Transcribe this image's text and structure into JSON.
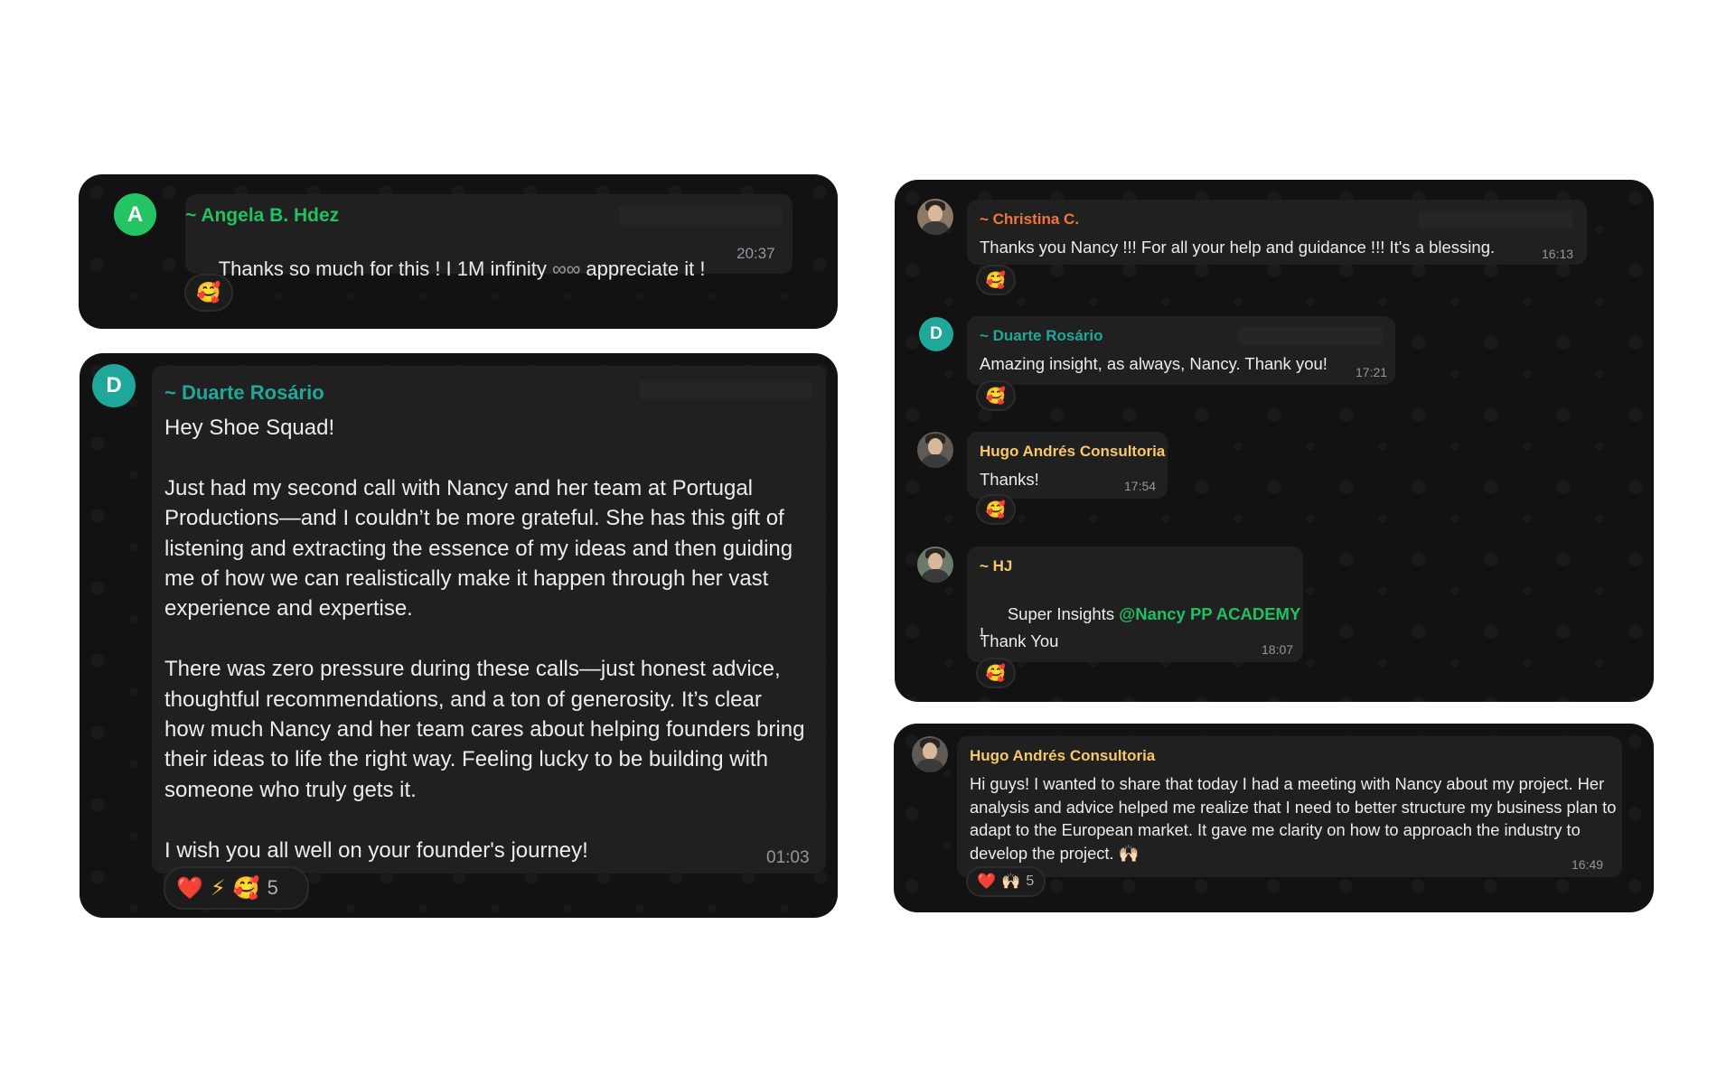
{
  "colors": {
    "card_bg": "#121212",
    "bubble_bg": "#202020",
    "text": "#e9edef",
    "meta": "#8f989e",
    "green": "#21c063",
    "teal": "#1fa89a",
    "orange": "#f0753a",
    "yellow": "#f7c76a"
  },
  "card1": {
    "avatar_letter": "A",
    "sender": "~ Angela B. Hdez",
    "text_before": "Thanks so much for this ! I 1M infinity ",
    "infinity_icon": "∞∞",
    "text_after": " appreciate it !",
    "time": "20:37",
    "reaction": "🥰"
  },
  "card2": {
    "avatar_letter": "D",
    "sender": "~ Duarte Rosário",
    "text": "Hey Shoe Squad!\n\nJust had my second call with Nancy and her team at Portugal Productions—and I couldn’t be more grateful. She has this gift of listening and extracting the essence of my ideas and then guiding me of how we can realistically make it happen through her vast experience and expertise.\n\nThere was zero pressure during these calls—just honest advice, thoughtful recommendations, and a ton of generosity. It’s clear how much Nancy and her team cares about helping founders bring their ideas to life the right way. Feeling lucky to be building with someone who truly gets it.\n\nI wish you all well on your founder's journey!",
    "time": "01:03",
    "reactions": [
      "❤️",
      "⚡",
      "🥰"
    ],
    "reaction_count": "5"
  },
  "card3": {
    "messages": [
      {
        "sender": "~ Christina C.",
        "text": "Thanks you Nancy !!! For all your help and guidance !!! It's a blessing.",
        "time": "16:13",
        "reaction": "🥰"
      },
      {
        "avatar_letter": "D",
        "sender": "~ Duarte Rosário",
        "text": "Amazing insight, as always, Nancy. Thank you!",
        "time": "17:21",
        "reaction": "🥰"
      },
      {
        "sender": "Hugo Andrés Consultoria",
        "text": "Thanks!",
        "time": "17:54",
        "reaction": "🥰"
      },
      {
        "sender": "~ HJ",
        "text_before": "Super Insights ",
        "mention": "@Nancy PP ACADEMY",
        "text_after": " !",
        "text_line2": "Thank You",
        "time": "18:07",
        "reaction": "🥰"
      }
    ]
  },
  "card4": {
    "sender": "Hugo Andrés Consultoria",
    "text": "Hi guys! I wanted to share that today I had a meeting with Nancy about my project. Her analysis and advice helped me realize that I need to better structure my business plan to adapt to the European market. It gave me clarity on how to approach the industry to develop the project. 🙌🏻",
    "time": "16:49",
    "reactions": [
      "❤️",
      "🙌🏻"
    ],
    "reaction_count": "5"
  }
}
